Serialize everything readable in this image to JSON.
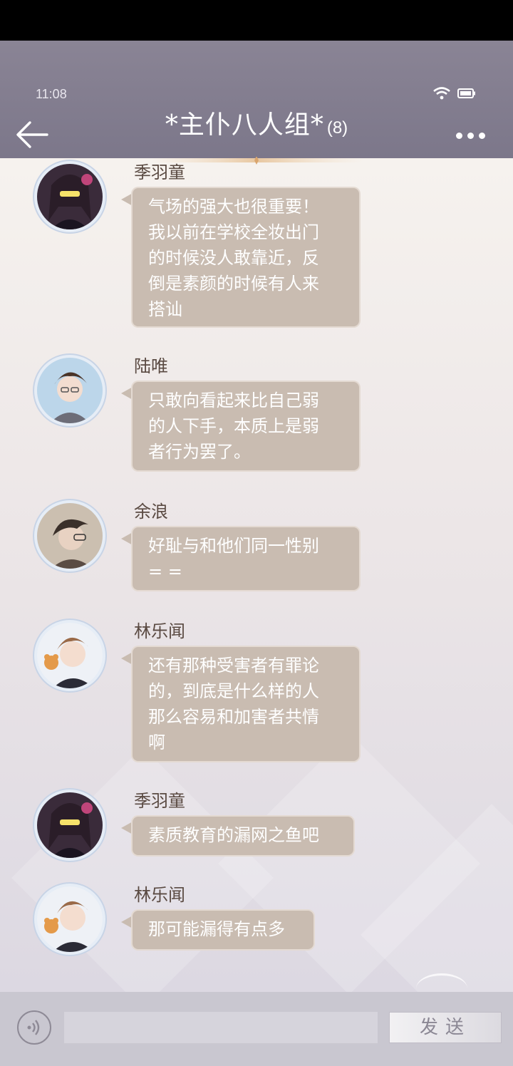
{
  "status_bar": {
    "time": "11:08"
  },
  "header": {
    "title": "*主仆八人组*",
    "member_count": "(8)"
  },
  "messages": [
    {
      "sender": "季羽童",
      "text": "气场的强大也很重要！\n我以前在学校全妆出门\n的时候没人敢靠近，反\n倒是素颜的时候有人来\n搭讪",
      "avatar": "avatar-jiyutong"
    },
    {
      "sender": "陆唯",
      "text": "只敢向看起来比自己弱\n的人下手，本质上是弱\n者行为罢了。",
      "avatar": "avatar-luwei"
    },
    {
      "sender": "余浪",
      "text": "好耻与和他们同一性别\n= =",
      "avatar": "avatar-yulang"
    },
    {
      "sender": "林乐闻",
      "text": "还有那种受害者有罪论\n的，到底是什么样的人\n那么容易和加害者共情\n啊",
      "avatar": "avatar-linlewen"
    },
    {
      "sender": "季羽童",
      "text": "素质教育的漏网之鱼吧",
      "avatar": "avatar-jiyutong"
    },
    {
      "sender": "林乐闻",
      "text": "那可能漏得有点多",
      "avatar": "avatar-linlewen"
    }
  ],
  "input": {
    "placeholder": "",
    "send_label": "发送"
  },
  "colors": {
    "header_bg": "#7c778a",
    "bubble": "#c9bcb1",
    "name_text": "#5a4a42"
  }
}
